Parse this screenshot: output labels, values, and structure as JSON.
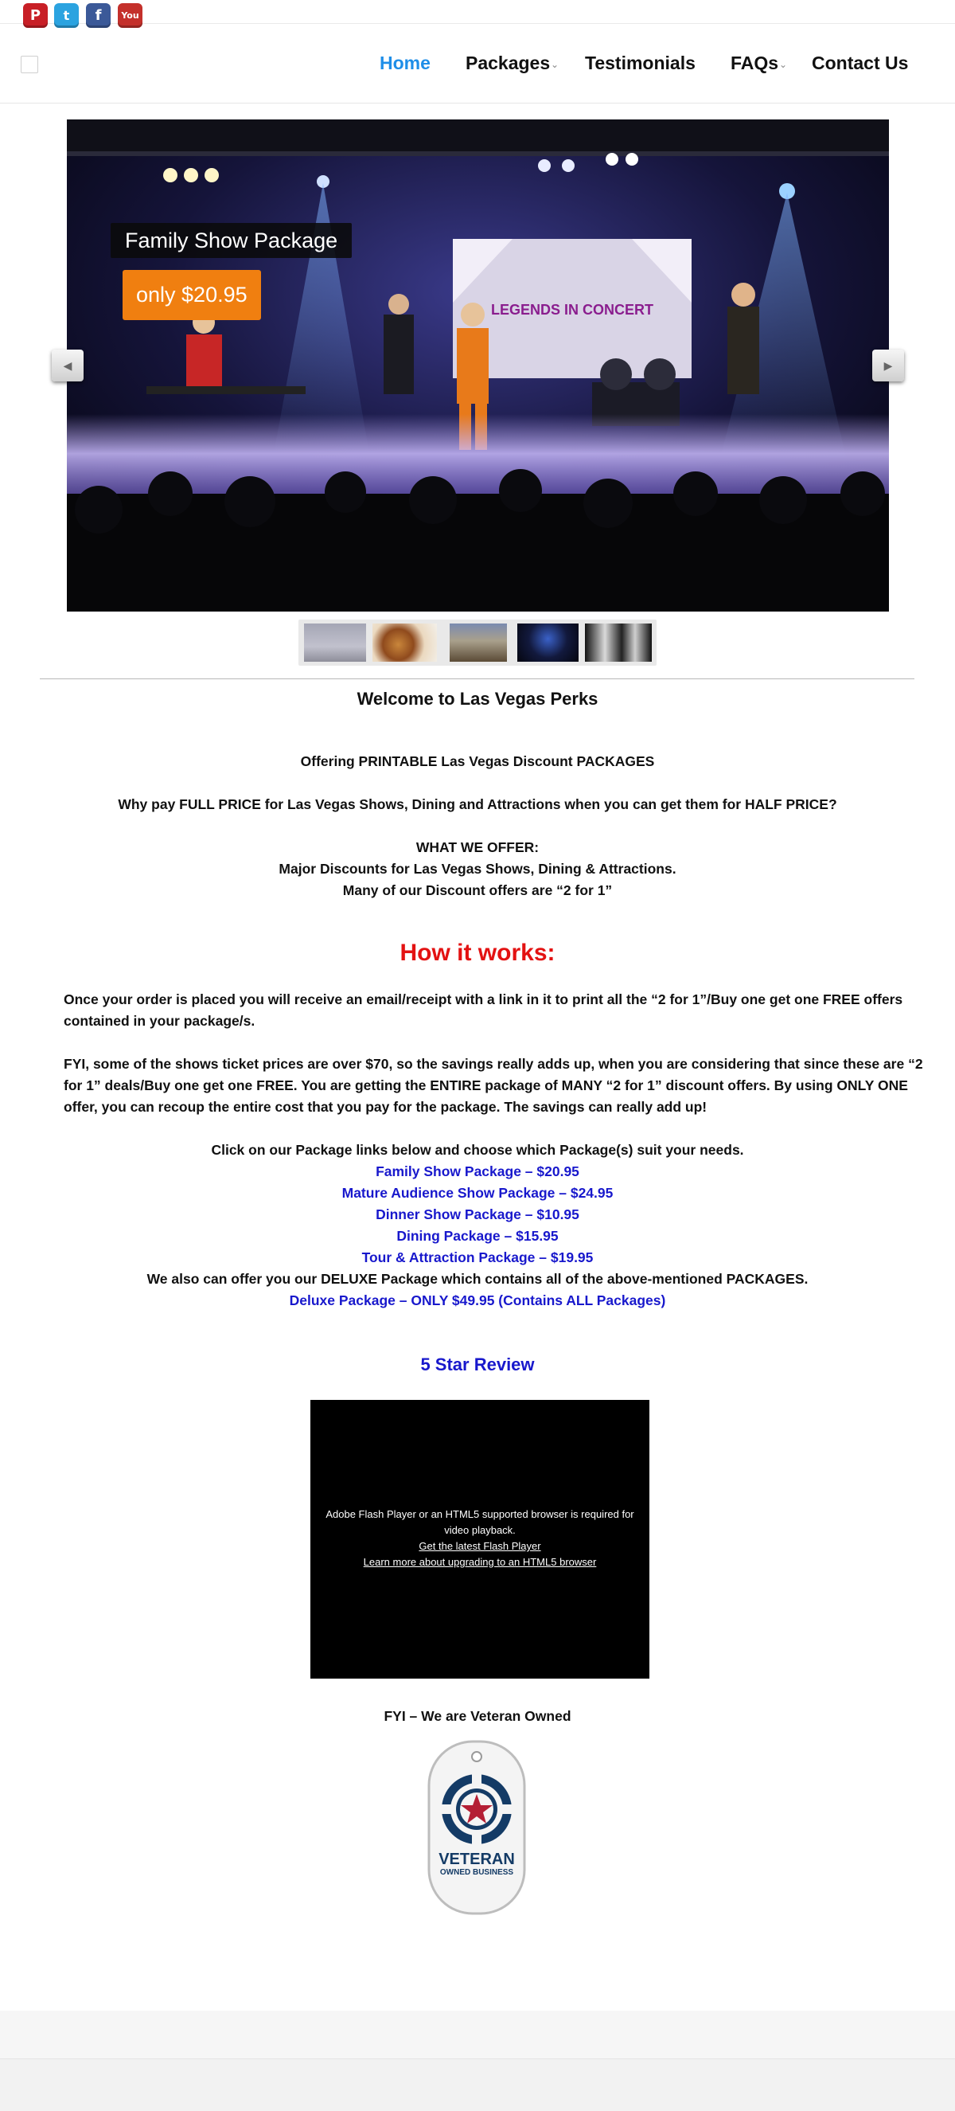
{
  "social": {
    "pinterest": "P",
    "twitter": "t",
    "facebook": "f",
    "youtube": "You"
  },
  "nav": {
    "items": [
      {
        "label": "Home",
        "active": true
      },
      {
        "label": "Packages",
        "has_dropdown": true
      },
      {
        "label": "Testimonials"
      },
      {
        "label": "FAQs",
        "has_dropdown": true
      },
      {
        "label": "Contact Us"
      }
    ],
    "active_color": "#1e8ee8"
  },
  "slider": {
    "caption_title": "Family Show Package",
    "caption_price": "only $20.95",
    "screen_text": "LEGENDS IN CONCERT",
    "price_color": "#f07f10",
    "thumbnail_count": 5
  },
  "welcome": {
    "title": "Welcome to Las Vegas Perks",
    "offering": "Offering PRINTABLE Las Vegas Discount PACKAGES",
    "why_pay": "Why pay FULL PRICE for Las Vegas Shows, Dining and Attractions when you can get them for HALF PRICE?",
    "what_we_offer": "WHAT WE OFFER:",
    "major_discounts": "Major Discounts  for Las Vegas Shows, Dining & Attractions.",
    "two_for_one": "Many of our Discount offers are “2 for 1”"
  },
  "how_it_works": {
    "title": "How it works:",
    "title_color": "#e31212",
    "para1": "Once your order is placed you will receive an email/receipt with a link in it to print all the “2 for 1”/Buy one get one FREE offers contained in your package/s.",
    "para2": "FYI, some of the shows ticket prices are over $70, so the savings really adds up, when you are considering that since these are  “2 for 1” deals/Buy one get one FREE. You are getting the ENTIRE package of MANY “2 for 1” discount offers.  By using ONLY ONE offer, you can recoup the entire cost that you pay for the package.  The savings can really add up!",
    "click_text": "Click on our Package links below and choose which Package(s) suit your needs.",
    "packages": [
      "Family Show Package – $20.95",
      "Mature Audience Show Package – $24.95",
      "Dinner Show Package – $10.95",
      "Dining Package – $15.95",
      "Tour & Attraction Package – $19.95"
    ],
    "deluxe_intro": "We also can offer you our DELUXE Package which contains all of the above-mentioned PACKAGES.",
    "deluxe_link": "Deluxe Package – ONLY $49.95 (Contains ALL Packages)",
    "link_color": "#1818cc"
  },
  "review": {
    "title": "5 Star Review",
    "video_msg": "Adobe Flash Player or an HTML5 supported browser is required for video playback.",
    "flash_link": "Get the latest Flash Player",
    "html5_link": "Learn more about upgrading to an HTML5 browser"
  },
  "veteran": {
    "text": "FYI – We are Veteran Owned",
    "badge_main": "VETERAN",
    "badge_sub": "OWNED BUSINESS"
  }
}
